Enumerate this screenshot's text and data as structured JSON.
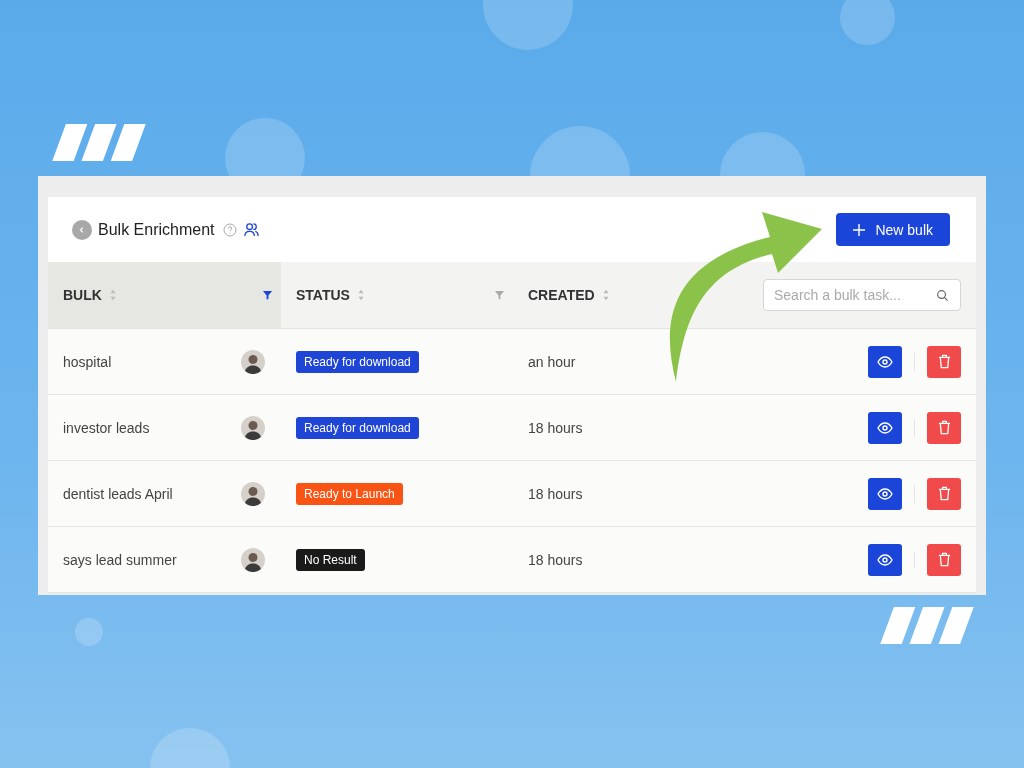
{
  "page": {
    "title": "Bulk Enrichment",
    "new_button": "New bulk"
  },
  "table": {
    "columns": [
      {
        "label": "BULK",
        "filter_active": true
      },
      {
        "label": "STATUS",
        "filter_active": false
      },
      {
        "label": "CREATED"
      }
    ],
    "search": {
      "placeholder": "Search a bulk task..."
    },
    "rows": [
      {
        "name": "hospital",
        "status": "Ready for download",
        "color": "#1f45d6",
        "created": "an hour"
      },
      {
        "name": "investor leads",
        "status": "Ready for download",
        "color": "#1f45d6",
        "created": "18 hours"
      },
      {
        "name": "dentist leads April",
        "status": "Ready to Launch",
        "color": "#fa5414",
        "created": "18 hours"
      },
      {
        "name": "says lead summer",
        "status": "No Result",
        "color": "#1a1a1a",
        "created": "18 hours"
      }
    ]
  }
}
